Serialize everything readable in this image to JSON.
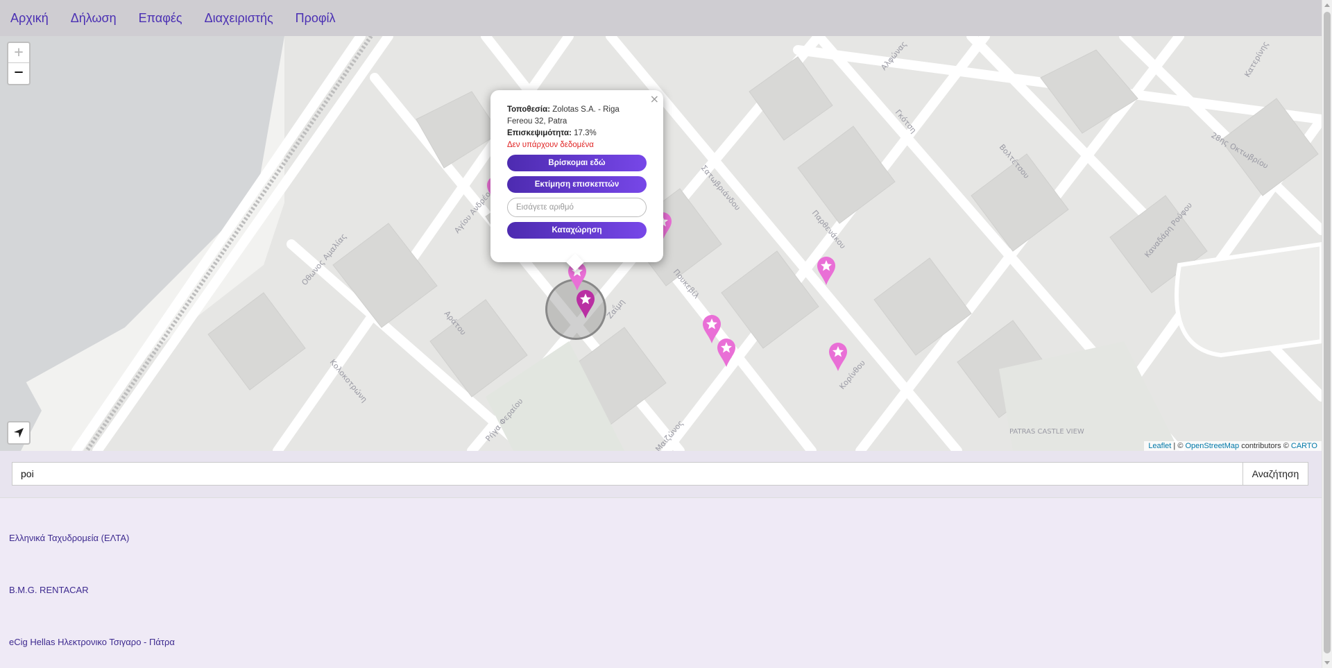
{
  "nav": {
    "items": [
      "Αρχική",
      "Δήλωση",
      "Επαφές",
      "Διαχειριστής",
      "Προφίλ"
    ]
  },
  "map": {
    "zoom_in": "+",
    "zoom_out": "−",
    "street_labels": [
      "Αγίου Ανδρέου",
      "Αράτου",
      "Ρήγα Φεραίου",
      "Ζαΐμη",
      "Μαιζώνος",
      "Πουκεβίλ",
      "Σατωβριάνδου",
      "Κορίνθου",
      "Γκότση",
      "28ης Οκτωβρίου",
      "Οθωνος Αμαλίας",
      "Κολοκοτρώνη",
      "Αλφώνας",
      "Παρθενάκου",
      "Βολτέτσου",
      "Καναδάρη Ρούφου",
      "Κατερίνης"
    ],
    "poi_label": "PATRAS CASTLE VIEW",
    "attribution": {
      "leaflet": "Leaflet",
      "sep": " | © ",
      "osm": "OpenStreetMap",
      "contrib": " contributors © ",
      "carto": "CARTO"
    },
    "colors": {
      "marker": "#e96fd6",
      "marker_dark": "#b92fa3",
      "accent": "#5b35c9"
    }
  },
  "popup": {
    "close": "×",
    "location_label": "Τοποθεσία:",
    "location_value": "Zolotas S.A. - Riga Fereou 32, Patra",
    "visits_label": "Επισκεψιμότητα:",
    "visits_value": "17.3%",
    "no_data": "Δεν υπάρχουν δεδομένα",
    "btn_here": "Βρίσκομαι εδώ",
    "btn_estimate": "Εκτίμηση επισκεπτών",
    "input_placeholder": "Εισάγετε αριθμό",
    "btn_submit": "Καταχώρηση"
  },
  "search": {
    "value": "poi",
    "button": "Αναζήτηση"
  },
  "results": [
    "Ελληνικά Ταχυδρομεία (ΕΛΤΑ)",
    "B.M.G. RENTACAR",
    "eCig Hellas Ηλεκτρονικο Τσιγαρο - Πάτρα"
  ]
}
